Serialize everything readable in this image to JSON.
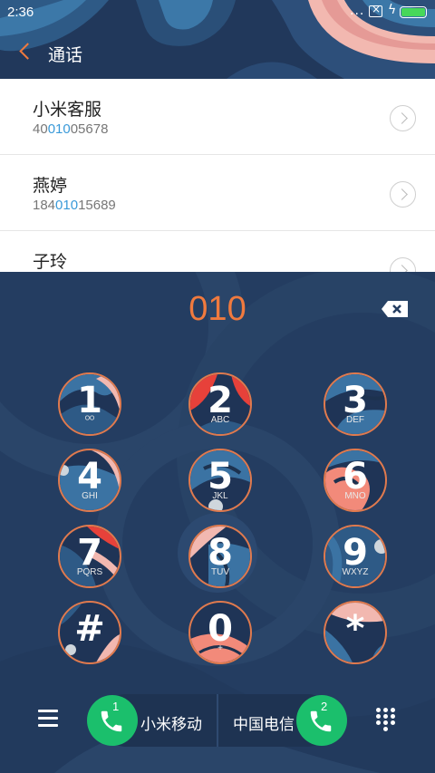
{
  "status_bar": {
    "time": "2:36",
    "dots": "...",
    "icons": [
      "sim-off-icon",
      "charging-icon",
      "battery-icon"
    ],
    "battery_color": "#47d85a"
  },
  "header": {
    "title": "通话",
    "back_icon": "chevron-left-icon",
    "accent": "#f07a3e"
  },
  "contacts": [
    {
      "name": "小米客服",
      "number_pre": "40",
      "number_match": "010",
      "number_post": "05678"
    },
    {
      "name": "燕婷",
      "number_pre": "184",
      "number_match": "010",
      "number_post": "15689"
    },
    {
      "name": "子玲",
      "number_pre": "",
      "number_match": "",
      "number_post": ""
    }
  ],
  "dialer": {
    "input": "010",
    "input_color": "#f07a3e",
    "backspace_icon": "backspace-icon",
    "keys": [
      {
        "main": "1",
        "sub": "ᴼᴼ"
      },
      {
        "main": "2",
        "sub": "ABC"
      },
      {
        "main": "3",
        "sub": "DEF"
      },
      {
        "main": "4",
        "sub": "GHI"
      },
      {
        "main": "5",
        "sub": "JKL"
      },
      {
        "main": "6",
        "sub": "MNO"
      },
      {
        "main": "7",
        "sub": "PQRS"
      },
      {
        "main": "8",
        "sub": "TUV"
      },
      {
        "main": "9",
        "sub": "WXYZ"
      },
      {
        "main": "#",
        "sub": ""
      },
      {
        "main": "0",
        "sub": "+"
      },
      {
        "main": "*",
        "sub": ""
      }
    ]
  },
  "bottom_bar": {
    "menu_icon": "menu-icon",
    "sim1": {
      "number": "1",
      "carrier": "小米移动"
    },
    "sim2": {
      "number": "2",
      "carrier": "中国电信"
    },
    "call_color": "#1bbf6c",
    "keypad_icon": "keypad-icon"
  }
}
